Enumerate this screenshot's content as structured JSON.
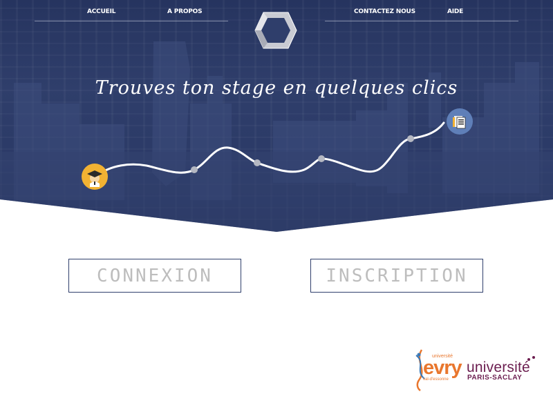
{
  "nav": {
    "items": [
      {
        "label": "ACCUEIL"
      },
      {
        "label": "A PROPOS"
      },
      {
        "label": "CONTACTEZ NOUS"
      },
      {
        "label": "AIDE"
      }
    ]
  },
  "hero": {
    "tagline": "Trouves ton stage en quelques clics"
  },
  "actions": {
    "login_label": "CONNEXION",
    "signup_label": "INSCRIPTION"
  },
  "partners": {
    "evry": {
      "small": "université",
      "name": "evry",
      "sub": "val-d'essonne"
    },
    "saclay": {
      "name": "université",
      "sub": "PARIS-SACLAY"
    }
  },
  "colors": {
    "hero_blue": "#2f3e6b",
    "button_border": "#2f3e6b",
    "button_text": "#bdbdbd",
    "student_marker": "#f2b233",
    "docs_marker": "#5f7fb8",
    "evry_orange": "#e9772e",
    "saclay_purple": "#6b1d4f"
  }
}
